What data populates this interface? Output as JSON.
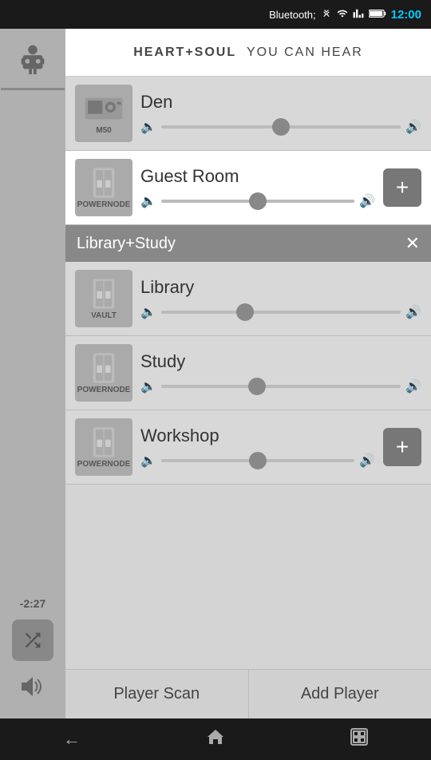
{
  "statusBar": {
    "time": "12:00",
    "icons": [
      "bluetooth",
      "signal-off",
      "wifi",
      "cellular",
      "battery"
    ]
  },
  "header": {
    "brand": "HEART+SOUL",
    "tagline": "YOU CAN HEAR"
  },
  "players": [
    {
      "id": "den",
      "name": "Den",
      "deviceModel": "M50",
      "sliderPos": "thumb-center",
      "group": null,
      "hasAddBtn": false
    },
    {
      "id": "guest-room",
      "name": "Guest Room",
      "deviceModel": "POWERNODE",
      "sliderPos": "thumb-center",
      "group": null,
      "hasAddBtn": true
    },
    {
      "id": "library",
      "name": "Library",
      "deviceModel": "VAULT",
      "sliderPos": "thumb-35",
      "group": "Library+Study",
      "hasAddBtn": false
    },
    {
      "id": "study",
      "name": "Study",
      "deviceModel": "POWERNODE",
      "sliderPos": "thumb-40",
      "group": "Library+Study",
      "hasAddBtn": false
    },
    {
      "id": "workshop",
      "name": "Workshop",
      "deviceModel": "POWERNODE",
      "sliderPos": "thumb-center",
      "group": null,
      "hasAddBtn": true
    }
  ],
  "groups": [
    {
      "id": "library-study",
      "name": "Library+Study"
    }
  ],
  "sidebar": {
    "timer": "-2:27"
  },
  "actionBar": {
    "playerScan": "Player Scan",
    "addPlayer": "Add Player"
  },
  "navBar": {
    "back": "←",
    "home": "⌂",
    "recent": "▣"
  }
}
